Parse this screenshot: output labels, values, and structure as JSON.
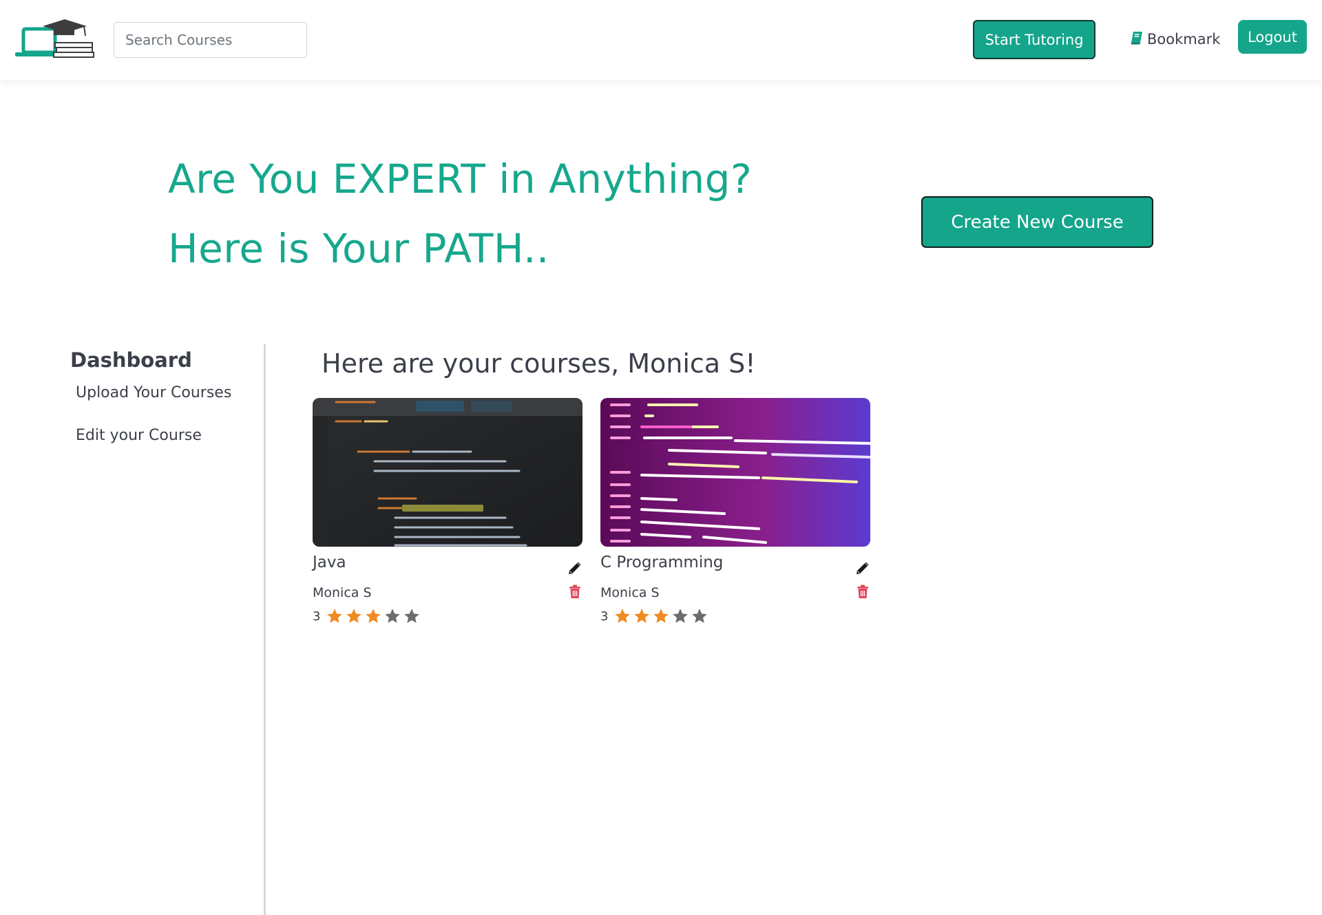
{
  "header": {
    "search_placeholder": "Search Courses",
    "start_tutoring_label": "Start Tutoring",
    "bookmark_label": "Bookmark",
    "logout_label": "Logout"
  },
  "hero": {
    "line1": "Are You EXPERT in Anything?",
    "line2": "Here is Your PATH..",
    "create_label": "Create New Course"
  },
  "sidebar": {
    "title": "Dashboard",
    "items": [
      {
        "label": "Upload Your Courses"
      },
      {
        "label": "Edit your Course"
      }
    ]
  },
  "main": {
    "welcome": "Here are your courses, Monica S!",
    "courses": [
      {
        "title": "Java",
        "author": "Monica S",
        "rating_label": "3",
        "rating": 3,
        "max_rating": 5,
        "thumbnail": "java-code-screenshot"
      },
      {
        "title": "C Programming",
        "author": "Monica S",
        "rating_label": "3",
        "rating": 3,
        "max_rating": 5,
        "thumbnail": "c-code-screenshot"
      }
    ]
  },
  "colors": {
    "accent": "#14a58b",
    "hero_text": "#16a88d",
    "star_filled": "#f08a24",
    "star_empty": "#6c6c6c",
    "danger": "#e0475a"
  }
}
